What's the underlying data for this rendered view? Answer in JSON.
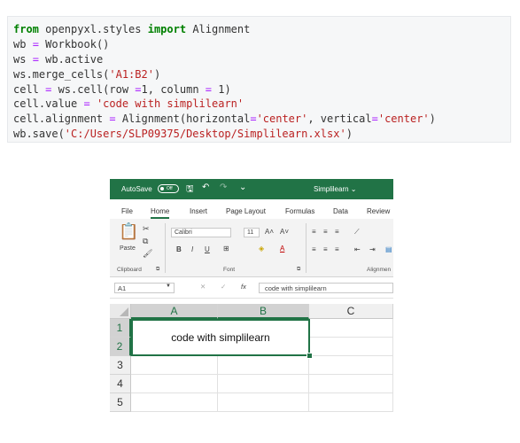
{
  "code": {
    "lines": [
      [
        {
          "t": "from",
          "c": "kw"
        },
        {
          "t": " openpyxl.styles ",
          "c": ""
        },
        {
          "t": "import",
          "c": "kw"
        },
        {
          "t": " Alignment",
          "c": ""
        }
      ],
      [
        {
          "t": "wb ",
          "c": ""
        },
        {
          "t": "=",
          "c": "op"
        },
        {
          "t": " Workbook()",
          "c": ""
        }
      ],
      [
        {
          "t": "ws ",
          "c": ""
        },
        {
          "t": "=",
          "c": "op"
        },
        {
          "t": " wb.active",
          "c": ""
        }
      ],
      [
        {
          "t": "ws.merge_cells(",
          "c": ""
        },
        {
          "t": "'A1:B2'",
          "c": "str"
        },
        {
          "t": ")",
          "c": ""
        }
      ],
      [
        {
          "t": "cell ",
          "c": ""
        },
        {
          "t": "=",
          "c": "op"
        },
        {
          "t": " ws.cell(row ",
          "c": ""
        },
        {
          "t": "=",
          "c": "op"
        },
        {
          "t": "1, column ",
          "c": ""
        },
        {
          "t": "=",
          "c": "op"
        },
        {
          "t": " 1)",
          "c": ""
        }
      ],
      [
        {
          "t": "cell.value ",
          "c": ""
        },
        {
          "t": "=",
          "c": "op"
        },
        {
          "t": " ",
          "c": ""
        },
        {
          "t": "'code with simplilearn'",
          "c": "str"
        }
      ],
      [
        {
          "t": "cell.alignment ",
          "c": ""
        },
        {
          "t": "=",
          "c": "op"
        },
        {
          "t": " Alignment(horizontal",
          "c": ""
        },
        {
          "t": "=",
          "c": "op"
        },
        {
          "t": "'center'",
          "c": "str"
        },
        {
          "t": ", vertical",
          "c": ""
        },
        {
          "t": "=",
          "c": "op"
        },
        {
          "t": "'center'",
          "c": "str"
        },
        {
          "t": ")",
          "c": ""
        }
      ],
      [
        {
          "t": "wb.save(",
          "c": ""
        },
        {
          "t": "'C:/Users/SLP09375/Desktop/Simplilearn.xlsx'",
          "c": "str"
        },
        {
          "t": ")",
          "c": ""
        }
      ]
    ]
  },
  "excel": {
    "autosave_label": "AutoSave",
    "autosave_state": "Off",
    "doc_title": "Simplilearn ⌄",
    "tabs": [
      "File",
      "Home",
      "Insert",
      "Page Layout",
      "Formulas",
      "Data",
      "Review"
    ],
    "ribbon": {
      "paste": "Paste",
      "font_name": "Calibri",
      "font_size": "11",
      "bold": "B",
      "italic": "I",
      "underline": "U",
      "groups": [
        "Clipboard",
        "Font",
        "Alignmen"
      ]
    },
    "name_box": "A1",
    "fx": "fx",
    "formula": "code with simplilearn",
    "columns": [
      "A",
      "B",
      "C"
    ],
    "rows": [
      "1",
      "2",
      "3",
      "4",
      "5"
    ],
    "merged_value": "code with simplilearn",
    "colors": {
      "brand": "#217346",
      "string": "#ba2121",
      "keyword": "#008000",
      "operator": "#aa22ff"
    }
  }
}
